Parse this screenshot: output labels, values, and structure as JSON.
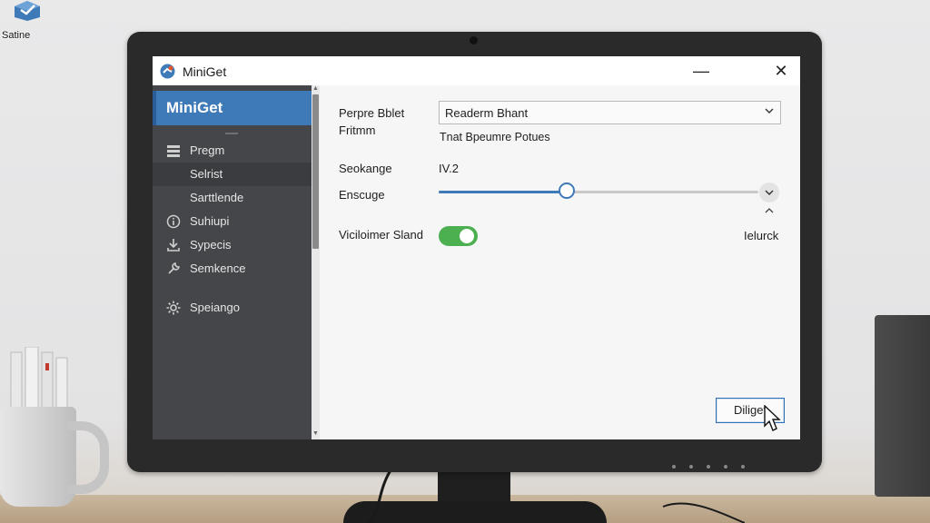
{
  "desktop": {
    "shortcut_label": "Satine"
  },
  "window": {
    "title": "MiniGet",
    "minimize_glyph": "—",
    "close_glyph": "✕"
  },
  "sidebar": {
    "header": "MiniGet",
    "items": [
      {
        "label": "Pregm",
        "icon": "list-icon"
      },
      {
        "label": "Selrist",
        "icon": ""
      },
      {
        "label": "Sarttlende",
        "icon": ""
      },
      {
        "label": "Suhiupi",
        "icon": "info-circle-icon"
      },
      {
        "label": "Sypecis",
        "icon": "download-icon"
      },
      {
        "label": "Semkence",
        "icon": "wrench-icon"
      },
      {
        "label": "Speiango",
        "icon": "gear-icon"
      }
    ]
  },
  "content": {
    "field1_label_line1": "Perpre Bblet",
    "field1_label_line2": "Fritmm",
    "select_value": "Readerm Bhant",
    "select_hint": "Tnat Bpeumre Potues",
    "version_label": "Seokange",
    "version_value": "IV.2",
    "slider_label": "Enscuge",
    "slider_value_percent": 40,
    "toggle_label": "Viciloimer Sland",
    "toggle_on": true,
    "side_note": "Ielurck",
    "button_label": "Diliget"
  },
  "colors": {
    "accent": "#3f7ab8",
    "sidebar_bg": "#444649",
    "toggle_on": "#4caf50"
  }
}
